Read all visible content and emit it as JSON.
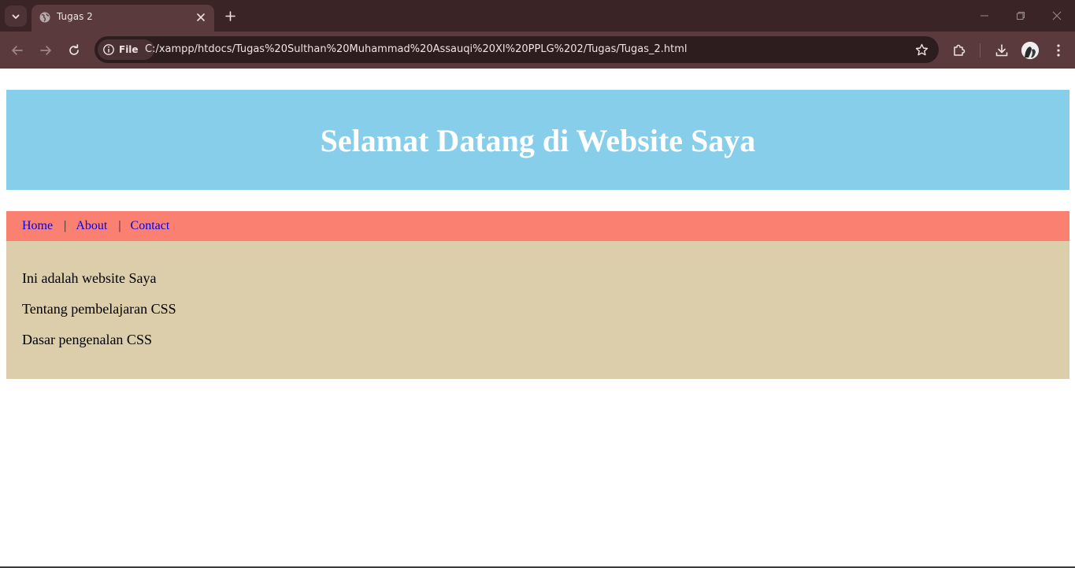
{
  "browser": {
    "tab_title": "Tugas 2",
    "omnibox": {
      "chip_label": "File",
      "url": "C:/xampp/htdocs/Tugas%20Sulthan%20Muhammad%20Assauqi%20XI%20PPLG%202/Tugas/Tugas_2.html"
    },
    "icons": {
      "tab_search": "chevron-down-icon",
      "favicon": "globe-icon",
      "close": "close-icon",
      "new_tab": "plus-icon",
      "back": "arrow-left-icon",
      "forward": "arrow-right-icon",
      "reload": "reload-icon",
      "site_info": "info-icon",
      "bookmark": "star-icon",
      "extensions": "puzzle-icon",
      "downloads": "download-icon",
      "menu": "kebab-menu-icon"
    },
    "colors": {
      "tabstrip": "#3a2426",
      "toolbar": "#5a3a3d",
      "omnibox": "#2e1d1f"
    }
  },
  "page": {
    "header_title": "Selamat Datang di Website Saya",
    "nav": {
      "items": [
        {
          "label": "Home"
        },
        {
          "label": "About"
        },
        {
          "label": "Contact"
        }
      ],
      "separator": "|"
    },
    "paragraphs": [
      "Ini adalah website Saya",
      "Tentang pembelajaran CSS",
      "Dasar pengenalan CSS"
    ],
    "colors": {
      "header_bg": "#87ceeb",
      "nav_bg": "#fa8072",
      "content_bg": "#dcceaa",
      "link": "#0000ee"
    }
  }
}
